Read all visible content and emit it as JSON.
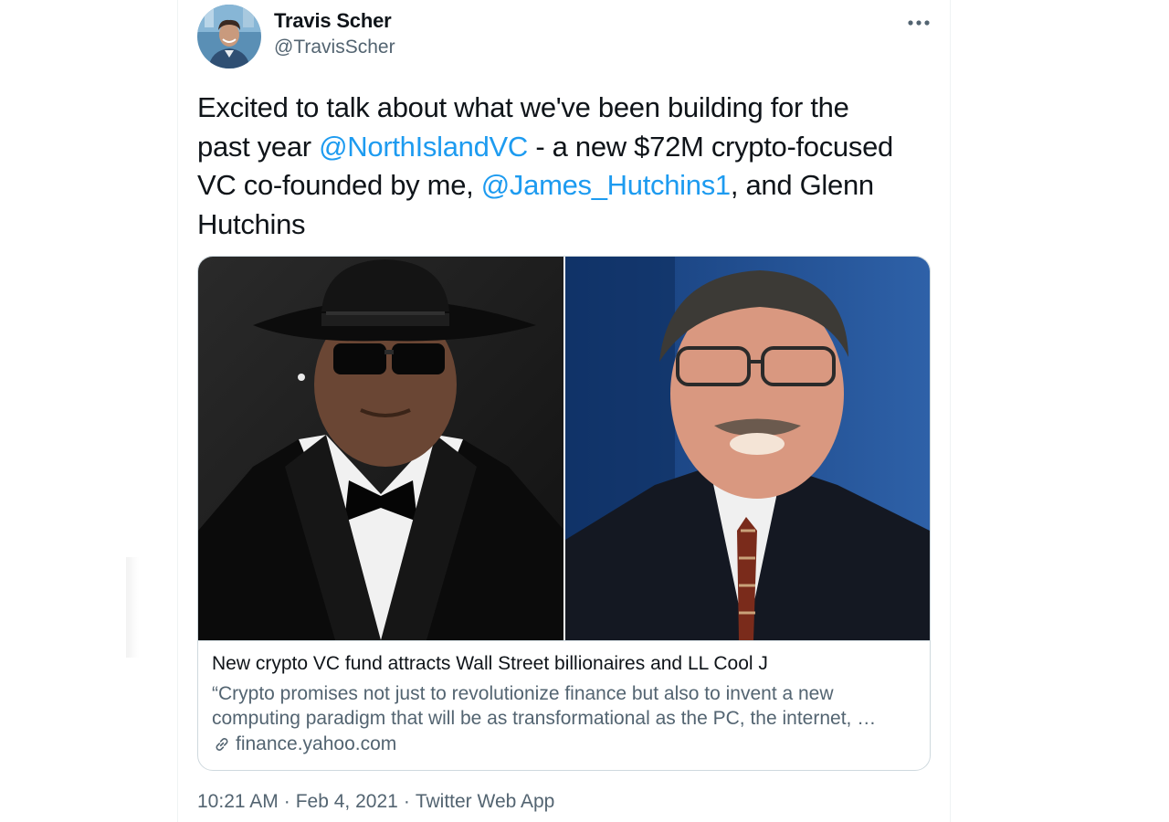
{
  "author": {
    "display_name": "Travis Scher",
    "handle": "@TravisScher",
    "avatar_icon": "avatar-photo"
  },
  "tweet": {
    "text_line1": "Excited to talk about what we've been building for the",
    "text_line2_pre": "past year ",
    "mention1": "@NorthIslandVC",
    "text_line2_post": " - a new $72M crypto-focused",
    "text_line3_pre": "VC co-founded by me, ",
    "mention2": "@James_Hutchins1",
    "text_line3_post": ", and Glenn",
    "text_line4": "Hutchins"
  },
  "card": {
    "title": "New crypto VC fund attracts Wall Street billionaires and LL Cool J",
    "desc_line1": "“Crypto promises not just to revolutionize finance but also to invent a new",
    "desc_line2": "computing paradigm that will be as transformational as the PC, the internet, …",
    "domain": "finance.yahoo.com",
    "link_icon": "link-icon"
  },
  "meta": {
    "time": "10:21 AM",
    "date": "Feb 4, 2021",
    "source": "Twitter Web App",
    "separator": "·"
  },
  "colors": {
    "accent": "#1d9bf0",
    "secondary_text": "#536471",
    "border": "#cfd9de"
  }
}
